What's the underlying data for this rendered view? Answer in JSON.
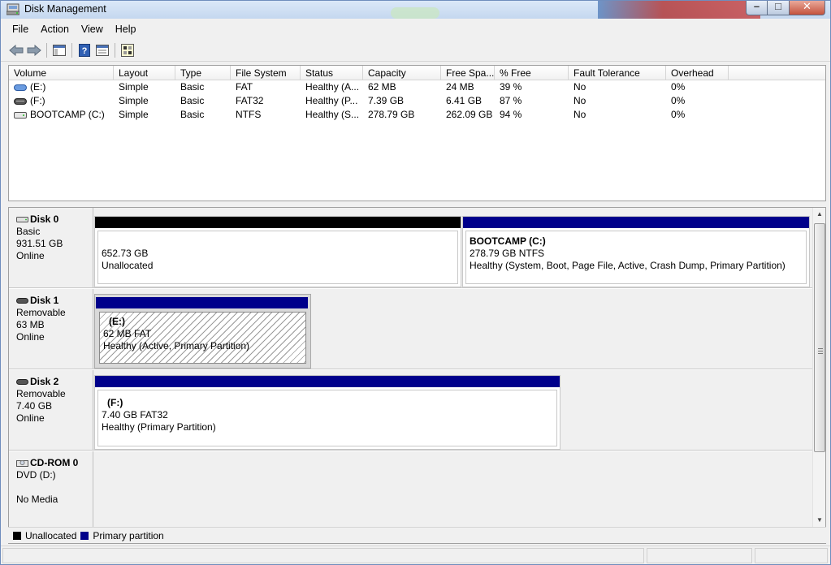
{
  "window": {
    "title": "Disk Management"
  },
  "menu": [
    "File",
    "Action",
    "View",
    "Help"
  ],
  "toolbar": [
    "back-icon",
    "forward-icon",
    "console-tree-icon",
    "help-icon",
    "properties-icon",
    "disk-settings-icon"
  ],
  "volume_list": {
    "columns": [
      "Volume",
      "Layout",
      "Type",
      "File System",
      "Status",
      "Capacity",
      "Free Spa...",
      "% Free",
      "Fault Tolerance",
      "Overhead"
    ],
    "rows": [
      {
        "volume": "(E:)",
        "layout": "Simple",
        "type": "Basic",
        "fs": "FAT",
        "status": "Healthy (A...",
        "capacity": "62 MB",
        "free": "24 MB",
        "pct": "39 %",
        "fault": "No",
        "overhead": "0%"
      },
      {
        "volume": "(F:)",
        "layout": "Simple",
        "type": "Basic",
        "fs": "FAT32",
        "status": "Healthy (P...",
        "capacity": "7.39 GB",
        "free": "6.41 GB",
        "pct": "87 %",
        "fault": "No",
        "overhead": "0%"
      },
      {
        "volume": "BOOTCAMP (C:)",
        "layout": "Simple",
        "type": "Basic",
        "fs": "NTFS",
        "status": "Healthy (S...",
        "capacity": "278.79 GB",
        "free": "262.09 GB",
        "pct": "94 %",
        "fault": "No",
        "overhead": "0%"
      }
    ]
  },
  "disks": [
    {
      "name": "Disk 0",
      "kind": "Basic",
      "size": "931.51 GB",
      "state": "Online",
      "partitions": [
        {
          "vname": "",
          "line1": "652.73 GB",
          "line2": "Unallocated"
        },
        {
          "vname": "BOOTCAMP  (C:)",
          "line1": "278.79 GB NTFS",
          "line2": "Healthy (System, Boot, Page File, Active, Crash Dump, Primary Partition)"
        }
      ]
    },
    {
      "name": "Disk 1",
      "kind": "Removable",
      "size": "63 MB",
      "state": "Online",
      "partitions": [
        {
          "vname": "(E:)",
          "line1": "62 MB FAT",
          "line2": "Healthy (Active, Primary Partition)"
        }
      ]
    },
    {
      "name": "Disk 2",
      "kind": "Removable",
      "size": "7.40 GB",
      "state": "Online",
      "partitions": [
        {
          "vname": "(F:)",
          "line1": "7.40 GB FAT32",
          "line2": "Healthy (Primary Partition)"
        }
      ]
    },
    {
      "name": "CD-ROM 0",
      "kind": "DVD (D:)",
      "size": "",
      "state": "No Media",
      "partitions": []
    }
  ],
  "legend": [
    {
      "label": "Unallocated",
      "color": "#000000"
    },
    {
      "label": "Primary partition",
      "color": "#00008b"
    }
  ]
}
